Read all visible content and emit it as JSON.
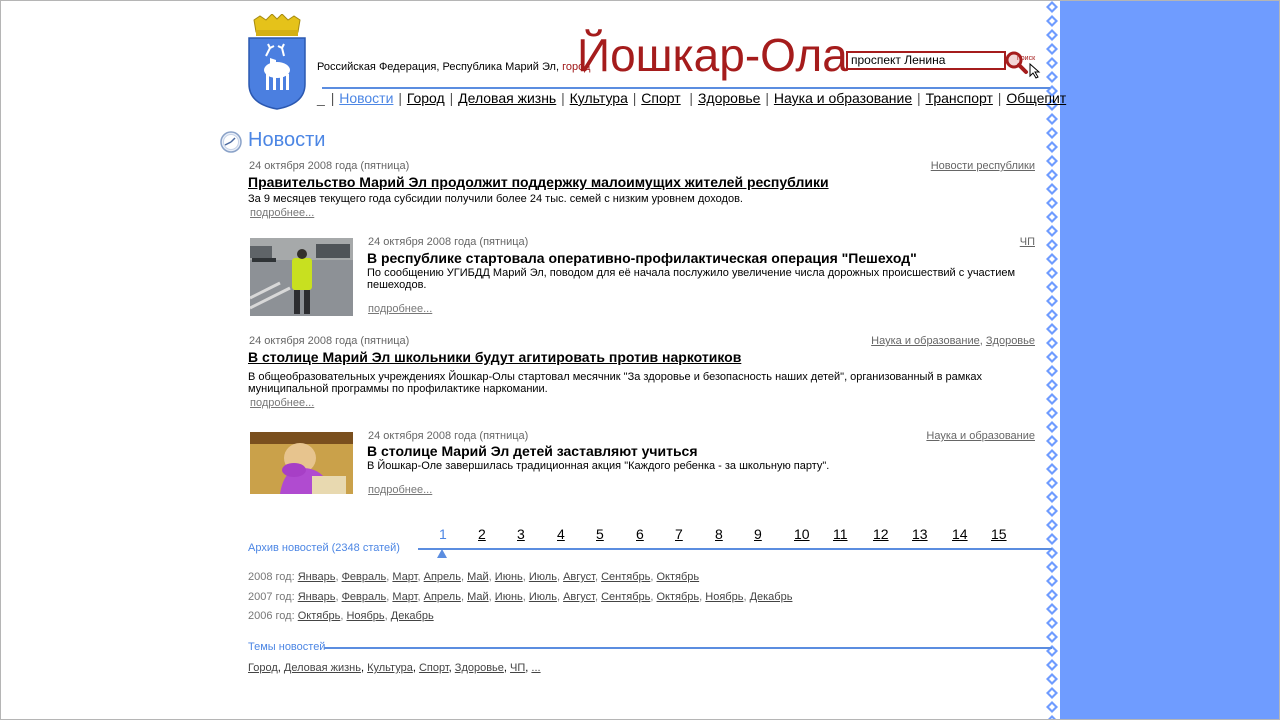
{
  "header": {
    "region_prefix": "Российская Федерация, Республика Марий Эл,",
    "region_city_word": "город",
    "city": "Йошкар-Ола",
    "search_value": "проспект Ленина",
    "search_button_label": "поиск"
  },
  "nav": {
    "lead_dash": "_",
    "items": [
      "Новости",
      "Город",
      "Деловая жизнь",
      "Культура",
      "Спорт",
      "Здоровье",
      "Наука и образование",
      "Транспорт",
      "Общепит"
    ]
  },
  "page_title": "Новости",
  "news": [
    {
      "date": "24 октября 2008 года (пятница)",
      "categories": [
        "Новости республики"
      ],
      "title": "Правительство Марий Эл продолжит поддержку малоимущих жителей республики",
      "lead": "За 9 месяцев текущего года субсидии получили более 24 тыс. семей с низким уровнем доходов.",
      "more": "подробнее..."
    },
    {
      "date": "24 октября 2008 года (пятница)",
      "categories": [
        "ЧП"
      ],
      "title": "В республике стартовала оперативно-профилактическая операция \"Пешеход\"",
      "lead": "По сообщению УГИБДД Марий Эл, поводом для её начала послужило увеличение числа дорожных происшествий с участием пешеходов.",
      "more": "подробнее..."
    },
    {
      "date": "24 октября 2008 года (пятница)",
      "categories": [
        "Наука и образование",
        "Здоровье"
      ],
      "title": "В столице Марий Эл школьники будут агитировать против наркотиков",
      "lead": "В общеобразовательных учреждениях Йошкар-Олы стартовал месячник \"За здоровье и безопасность наших детей\", организованный в рамках муниципальной программы по профилактике наркомании.",
      "more": "подробнее..."
    },
    {
      "date": "24 октября 2008 года (пятница)",
      "categories": [
        "Наука и образование"
      ],
      "title": "В столице Марий Эл детей заставляют учиться",
      "lead": "В Йошкар-Оле завершилась традиционная акция \"Каждого ребенка - за школьную парту\".",
      "more": "подробнее..."
    }
  ],
  "pagination": {
    "current": 1,
    "pages": [
      "1",
      "2",
      "3",
      "4",
      "5",
      "6",
      "7",
      "8",
      "9",
      "10",
      "11",
      "12",
      "13",
      "14",
      "15"
    ]
  },
  "archive": {
    "title": "Архив новостей (2348 статей)",
    "years": [
      {
        "label": "2008 год:",
        "months": [
          "Январь",
          "Февраль",
          "Март",
          "Апрель",
          "Май",
          "Июнь",
          "Июль",
          "Август",
          "Сентябрь",
          "Октябрь"
        ]
      },
      {
        "label": "2007 год:",
        "months": [
          "Январь",
          "Февраль",
          "Март",
          "Апрель",
          "Май",
          "Июнь",
          "Июль",
          "Август",
          "Сентябрь",
          "Октябрь",
          "Ноябрь",
          "Декабрь"
        ]
      },
      {
        "label": "2006 год:",
        "months": [
          "Октябрь",
          "Ноябрь",
          "Декабрь"
        ]
      }
    ]
  },
  "themes": {
    "title": "Темы новостей",
    "items": [
      "Город",
      "Деловая жизнь",
      "Культура",
      "Спорт",
      "Здоровье",
      "ЧП",
      "..."
    ]
  },
  "colors": {
    "brand_red": "#a51c1c",
    "accent_blue": "#4c86e4",
    "panel_blue": "#6f9cff"
  },
  "icons": {
    "coat": "coat-of-arms-icon",
    "search": "magnifier-icon",
    "clock": "clock-icon"
  }
}
